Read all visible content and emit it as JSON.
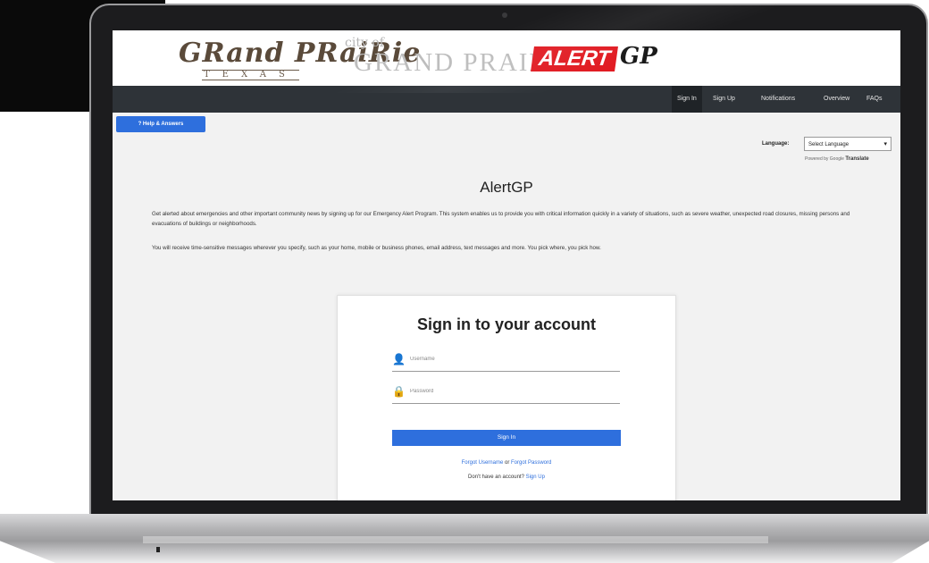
{
  "header": {
    "logo_grand_prairie": "GRand PRaiRie",
    "logo_texas": "TEXAS",
    "logo_city_of": "city of",
    "logo_city_name": "GRAND PRAIRIE",
    "logo_alert": "ALERT",
    "logo_gp": "GP"
  },
  "nav": {
    "items": [
      {
        "label": "Sign In",
        "active": true
      },
      {
        "label": "Sign Up",
        "active": false
      },
      {
        "label": "Notifications",
        "active": false
      },
      {
        "label": "Overview",
        "active": false
      },
      {
        "label": "FAQs",
        "active": false
      }
    ]
  },
  "help_button": {
    "label": "? Help & Answers"
  },
  "language": {
    "label": "Language:",
    "selected": "Select Language",
    "powered_by": "Powered by",
    "google": "Google",
    "translate": "Translate"
  },
  "main": {
    "title": "AlertGP",
    "intro_paragraph": "Get alerted about emergencies and other important community news by signing up for our Emergency Alert Program. This system enables us to provide you with critical information quickly in a variety of situations, such as severe weather, unexpected road closures, missing persons and evacuations of buildings or neighborhoods.",
    "second_paragraph": "You will receive time-sensitive messages wherever you specify, such as your home, mobile or business phones, email address, text messages and more. You pick where, you pick how."
  },
  "signin_card": {
    "title": "Sign in to your account",
    "username_placeholder": "Username",
    "password_placeholder": "Password",
    "signin_button": "Sign In",
    "forgot_username": "Forgot Username",
    "or": "or",
    "forgot_password": "Forgot Password",
    "no_account": "Don't have an account?",
    "sign_up_link": "Sign Up"
  },
  "icons": {
    "username": "user-icon",
    "password": "lock-icon",
    "language_caret": "chevron-down-icon"
  },
  "colors": {
    "nav_bg": "#2e3338",
    "primary_blue": "#2e6fdd",
    "alert_red": "#e11b22"
  }
}
